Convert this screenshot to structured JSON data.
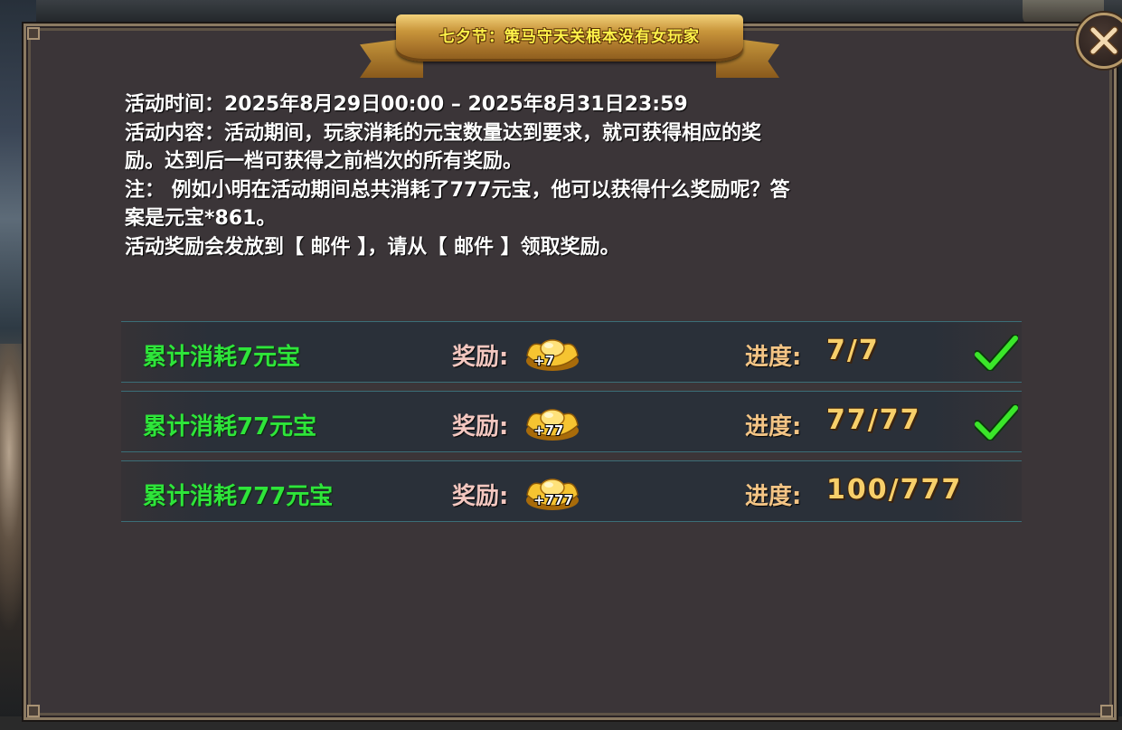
{
  "banner": {
    "title": "七夕节：策马守天关根本没有女玩家"
  },
  "close_button": {
    "icon": "close-icon"
  },
  "description": {
    "lines": [
      "活动时间：2025年8月29日00:00 – 2025年8月31日23:59",
      "活动内容：活动期间，玩家消耗的元宝数量达到要求，就可获得相应的奖",
      "励。达到后一档可获得之前档次的所有奖励。",
      "注： 例如小明在活动期间总共消耗了777元宝，他可以获得什么奖励呢？答",
      "案是元宝*861。",
      "活动奖励会发放到【 邮件 】，请从【 邮件 】领取奖励。"
    ]
  },
  "rows": [
    {
      "name": "累计消耗7元宝",
      "reward_label": "奖励:",
      "reward_amount": "+7",
      "progress_label": "进度:",
      "progress_value": "7/7",
      "completed": true
    },
    {
      "name": "累计消耗77元宝",
      "reward_label": "奖励:",
      "reward_amount": "+77",
      "progress_label": "进度:",
      "progress_value": "77/77",
      "completed": true
    },
    {
      "name": "累计消耗777元宝",
      "reward_label": "奖励:",
      "reward_amount": "+777",
      "progress_label": "进度:",
      "progress_value": "100/777",
      "completed": false
    }
  ],
  "colors": {
    "row_name": "#2ee53a",
    "progress_value": "#f7cf6a",
    "check": "#3be62a",
    "banner_text": "#fff34a"
  }
}
